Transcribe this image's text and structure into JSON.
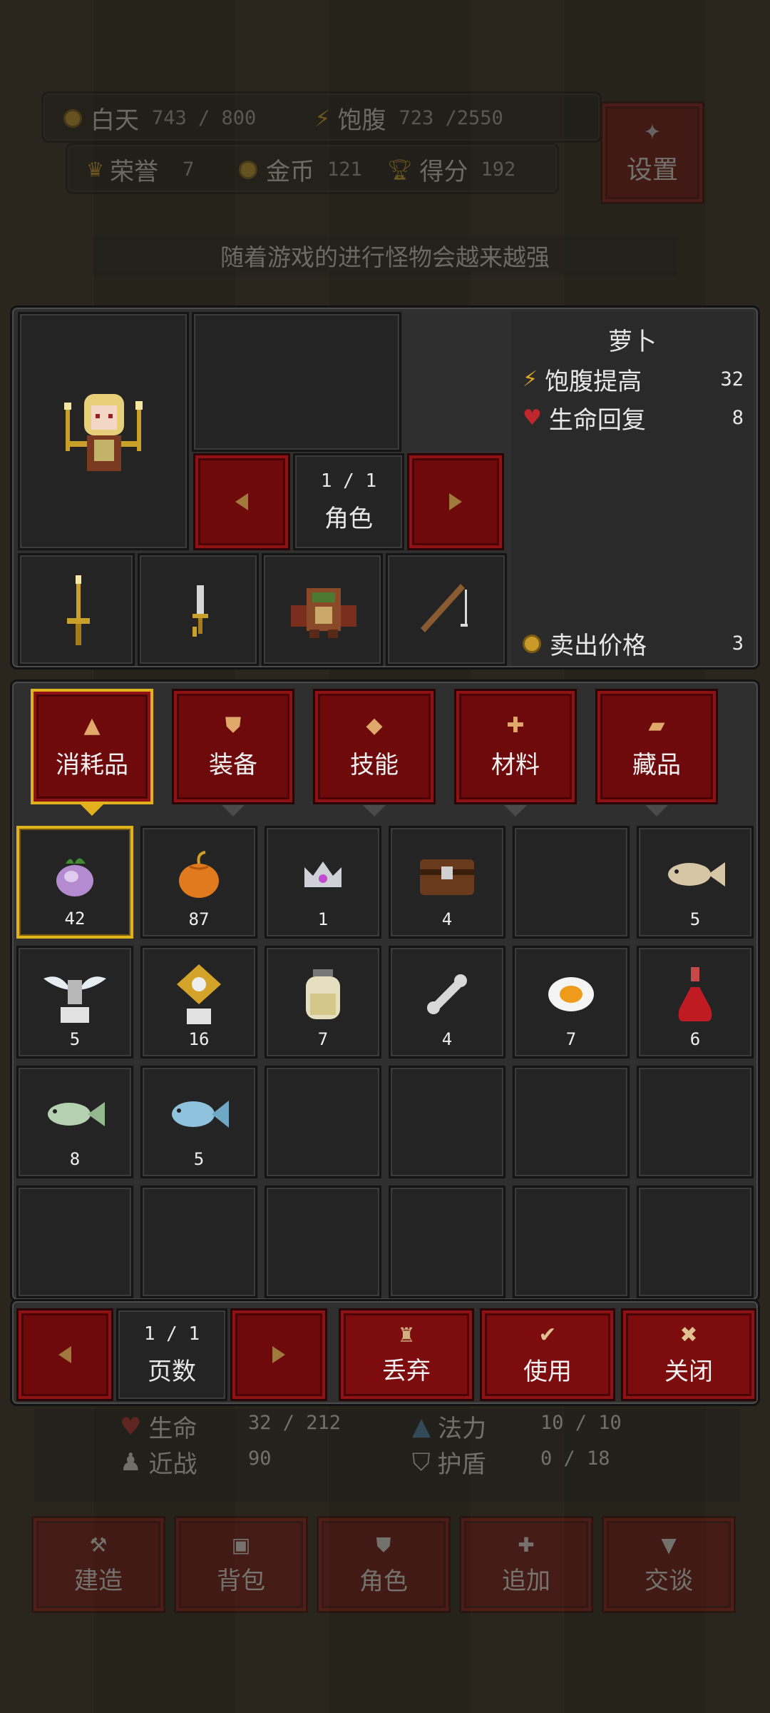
{
  "hud": {
    "day_label": "白天",
    "day_value": "743 / 800",
    "hunger_label": "饱腹",
    "hunger_value": "723 /2550",
    "honor_label": "荣誉",
    "honor_value": "7",
    "gold_label": "金币",
    "gold_value": "121",
    "score_label": "得分",
    "score_value": "192",
    "settings_label": "设置"
  },
  "tip": "随着游戏的进行怪物会越来越强",
  "character": {
    "page": "1  /  1",
    "page_label": "角色"
  },
  "item_detail": {
    "name": "萝卜",
    "stats": [
      {
        "label": "饱腹提高",
        "value": "32",
        "icon": "hunger-icon"
      },
      {
        "label": "生命回复",
        "value": "8",
        "icon": "heart-plus-icon"
      }
    ],
    "sell_label": "卖出价格",
    "sell_value": "3"
  },
  "equipment": [
    "candle-sword-icon",
    "dagger-icon",
    "armor-icon",
    "fishing-rod-icon"
  ],
  "tabs": [
    {
      "label": "消耗品",
      "icon": "flask-icon",
      "active": true
    },
    {
      "label": "装备",
      "icon": "shield-icon",
      "active": false
    },
    {
      "label": "技能",
      "icon": "diamond-icon",
      "active": false
    },
    {
      "label": "材料",
      "icon": "cross-icon",
      "active": false
    },
    {
      "label": "藏品",
      "icon": "scroll-icon",
      "active": false
    }
  ],
  "inventory": [
    {
      "icon": "turnip-icon",
      "count": "42"
    },
    {
      "icon": "pumpkin-icon",
      "count": "87"
    },
    {
      "icon": "crown-icon",
      "count": "1"
    },
    {
      "icon": "chest-icon",
      "count": "4"
    },
    {
      "icon": "",
      "count": ""
    },
    {
      "icon": "fish-bone-icon",
      "count": "5"
    },
    {
      "icon": "winged-statue-icon",
      "count": "5"
    },
    {
      "icon": "golden-statue-icon",
      "count": "16"
    },
    {
      "icon": "jar-icon",
      "count": "7"
    },
    {
      "icon": "bone-icon",
      "count": "4"
    },
    {
      "icon": "fried-egg-icon",
      "count": "7"
    },
    {
      "icon": "red-potion-icon",
      "count": "6"
    },
    {
      "icon": "green-fish-icon",
      "count": "8"
    },
    {
      "icon": "blue-fish-icon",
      "count": "5"
    },
    {
      "icon": "",
      "count": ""
    },
    {
      "icon": "",
      "count": ""
    },
    {
      "icon": "",
      "count": ""
    },
    {
      "icon": "",
      "count": ""
    },
    {
      "icon": "",
      "count": ""
    },
    {
      "icon": "",
      "count": ""
    },
    {
      "icon": "",
      "count": ""
    },
    {
      "icon": "",
      "count": ""
    },
    {
      "icon": "",
      "count": ""
    },
    {
      "icon": "",
      "count": ""
    }
  ],
  "bottom": {
    "page": "1  /  1",
    "page_label": "页数",
    "discard_label": "丢弃",
    "use_label": "使用",
    "close_label": "关闭"
  },
  "status_behind": {
    "hp_label": "生命",
    "hp_value": "32 / 212",
    "mp_label": "法力",
    "mp_value": "10 / 10",
    "melee_label": "近战",
    "melee_value": "90",
    "shield_label": "护盾",
    "shield_value": "0 / 18"
  },
  "nav": [
    {
      "label": "建造",
      "icon": "build-icon"
    },
    {
      "label": "背包",
      "icon": "bag-icon"
    },
    {
      "label": "角色",
      "icon": "character-icon"
    },
    {
      "label": "追加",
      "icon": "plus-icon"
    },
    {
      "label": "交谈",
      "icon": "chat-icon"
    }
  ],
  "colors": {
    "accent": "#e2b21d",
    "button_red": "#6f0a0c",
    "panel": "#2f2f2f"
  }
}
